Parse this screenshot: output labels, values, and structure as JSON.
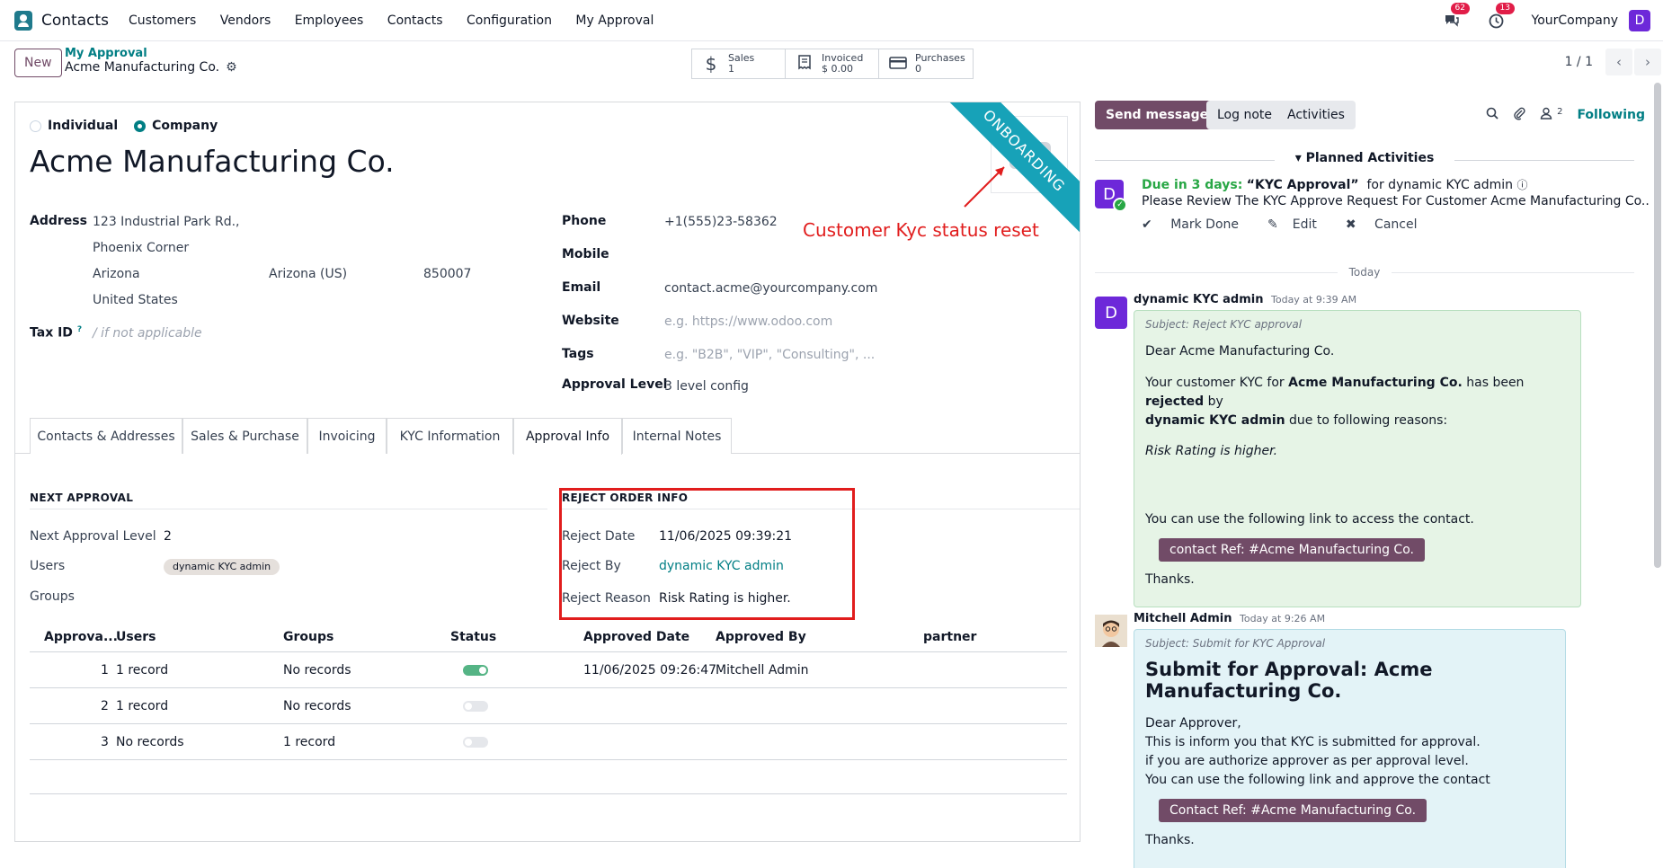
{
  "navbar": {
    "app_name": "Contacts",
    "menu": [
      "Customers",
      "Vendors",
      "Employees",
      "Contacts",
      "Configuration",
      "My Approval"
    ],
    "messages_count": "62",
    "activities_count": "13",
    "company": "YourCompany",
    "user_initial": "D"
  },
  "control": {
    "new_label": "New",
    "breadcrumb_parent": "My Approval",
    "breadcrumb_current": "Acme Manufacturing Co.",
    "smart_buttons": [
      {
        "label": "Sales",
        "value": "1",
        "icon": "dollar-icon"
      },
      {
        "label": "Invoiced",
        "value": "$ 0.00",
        "icon": "invoice-icon"
      },
      {
        "label": "Purchases",
        "value": "0",
        "icon": "credit-card-icon"
      }
    ],
    "pager": "1 / 1"
  },
  "form": {
    "type_individual": "Individual",
    "type_company": "Company",
    "name": "Acme Manufacturing Co.",
    "ribbon": "ONBOARDING",
    "annotation": "Customer Kyc status reset",
    "address_label": "Address",
    "street": "123 Industrial Park Rd.,",
    "street2": "Phoenix Corner",
    "city": "Arizona",
    "state": "Arizona (US)",
    "zip": "850007",
    "country": "United States",
    "tax_label": "Tax ID",
    "tax_help": "?",
    "tax_placeholder": "/ if not applicable",
    "phone_label": "Phone",
    "phone": "+1(555)23-58362",
    "mobile_label": "Mobile",
    "email_label": "Email",
    "email": "contact.acme@yourcompany.com",
    "website_label": "Website",
    "website_placeholder": "e.g. https://www.odoo.com",
    "tags_label": "Tags",
    "tags_placeholder": "e.g. \"B2B\", \"VIP\", \"Consulting\", ...",
    "approval_level_label": "Approval Level",
    "approval_level": "3 level config"
  },
  "tabs": [
    "Contacts & Addresses",
    "Sales & Purchase",
    "Invoicing",
    "KYC Information",
    "Approval Info",
    "Internal Notes"
  ],
  "approval": {
    "next_title": "NEXT APPROVAL",
    "next_level_label": "Next Approval Level",
    "next_level": "2",
    "users_label": "Users",
    "users_tag": "dynamic KYC admin",
    "groups_label": "Groups",
    "reject_title": "REJECT ORDER INFO",
    "reject_date_label": "Reject Date",
    "reject_date": "11/06/2025 09:39:21",
    "reject_by_label": "Reject By",
    "reject_by": "dynamic KYC admin",
    "reject_reason_label": "Reject Reason",
    "reject_reason": "Risk Rating is higher."
  },
  "table": {
    "headers": [
      "Approva...",
      "Users",
      "Groups",
      "Status",
      "Approved Date",
      "Approved By",
      "partner"
    ],
    "rows": [
      {
        "level": "1",
        "users": "1 record",
        "groups": "No records",
        "status_on": true,
        "approved_date": "11/06/2025 09:26:47",
        "approved_by": "Mitchell Admin"
      },
      {
        "level": "2",
        "users": "1 record",
        "groups": "No records",
        "status_on": false,
        "approved_date": "",
        "approved_by": ""
      },
      {
        "level": "3",
        "users": "No records",
        "groups": "1 record",
        "status_on": false,
        "approved_date": "",
        "approved_by": ""
      }
    ]
  },
  "chatter": {
    "send_message": "Send message",
    "log_note": "Log note",
    "activities": "Activities",
    "followers_count": "2",
    "following": "Following",
    "planned_title": "Planned Activities",
    "activity": {
      "avatar": "D",
      "due": "Due in 3 days:",
      "title": "“KYC Approval”",
      "for": "for dynamic KYC admin",
      "note": "Please Review The KYC Approve Request For Customer Acme Manufacturing Co..",
      "mark_done": "Mark Done",
      "edit": "Edit",
      "cancel": "Cancel"
    },
    "today": "Today",
    "msg1": {
      "avatar": "D",
      "author": "dynamic KYC admin",
      "time": "Today at 9:39 AM",
      "subject": "Subject: Reject KYC approval",
      "greeting": "Dear Acme Manufacturing Co.",
      "p1_a": "Your customer KYC for ",
      "p1_b": "Acme Manufacturing Co.",
      "p1_c": " has been ",
      "p1_d": "rejected",
      "p1_e": " by",
      "p1_f": "dynamic KYC admin",
      "p1_g": " due to following reasons:",
      "reason": "Risk Rating is higher.",
      "link_text": "You can use the following link to access the contact.",
      "button": "contact Ref: #Acme Manufacturing Co.",
      "thanks": "Thanks."
    },
    "msg2": {
      "author": "Mitchell Admin",
      "time": "Today at 9:26 AM",
      "subject": "Subject: Submit for KYC Approval",
      "heading": "Submit for Approval: Acme Manufacturing Co.",
      "line1": "Dear Approver,",
      "line2": "This is inform you that KYC is submitted for approval.",
      "line3": "if you are authorize approver as per approval level.",
      "line4": "You can use the following link and approve the contact",
      "button": "Contact Ref: #Acme Manufacturing Co.",
      "thanks": "Thanks."
    }
  }
}
